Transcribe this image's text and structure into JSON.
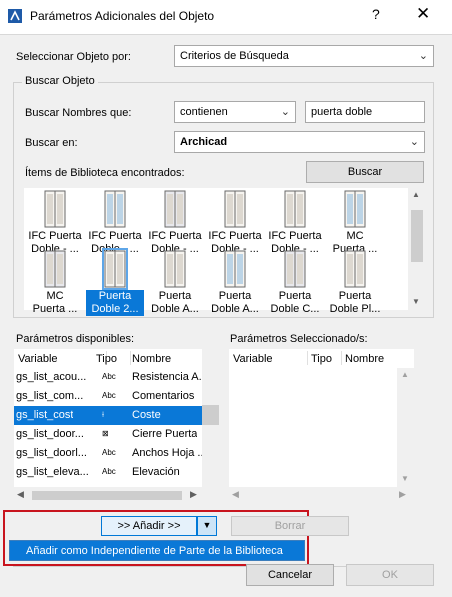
{
  "window": {
    "title": "Parámetros Adicionales del Objeto",
    "help": "?",
    "close": "✕"
  },
  "select_by": {
    "label": "Seleccionar Objeto por:",
    "value": "Criterios de Búsqueda"
  },
  "search": {
    "group_label": "Buscar Objeto",
    "names_label": "Buscar Nombres que:",
    "condition": "contienen",
    "query": "puerta doble",
    "search_in_label": "Buscar en:",
    "search_in": "Archicad",
    "found_label": "Ítems de Biblioteca encontrados:",
    "search_button": "Buscar"
  },
  "library_items": [
    {
      "label": "IFC Puerta\nDoble - ...",
      "icon": "door-icon"
    },
    {
      "label": "IFC Puerta\nDoble - ...",
      "icon": "door-icon"
    },
    {
      "label": "IFC Puerta\nDoble - ...",
      "icon": "door-icon"
    },
    {
      "label": "IFC Puerta\nDoble - ...",
      "icon": "door-icon"
    },
    {
      "label": "IFC Puerta\nDoble - ...",
      "icon": "door-icon"
    },
    {
      "label": "MC\nPuerta ...",
      "icon": "door-icon"
    },
    {
      "label": "MC\nPuerta ...",
      "icon": "door-icon"
    },
    {
      "label": "Puerta\nDoble 2...",
      "icon": "door-icon"
    },
    {
      "label": "Puerta\nDoble A...",
      "icon": "door-icon"
    },
    {
      "label": "Puerta\nDoble A...",
      "icon": "door-icon"
    },
    {
      "label": "Puerta\nDoble C...",
      "icon": "door-icon"
    },
    {
      "label": "Puerta\nDoble Pl...",
      "icon": "door-icon"
    }
  ],
  "available": {
    "label": "Parámetros disponibles:",
    "headers": {
      "variable": "Variable",
      "tipo": "Tipo",
      "nombre": "Nombre"
    },
    "rows": [
      {
        "variable": "gs_list_acou...",
        "tipo": "Abc",
        "nombre": "Resistencia A..."
      },
      {
        "variable": "gs_list_com...",
        "tipo": "Abc",
        "nombre": "Comentarios"
      },
      {
        "variable": "gs_list_cost",
        "tipo": "⟊",
        "nombre": "Coste"
      },
      {
        "variable": "gs_list_door...",
        "tipo": "⊠",
        "nombre": "Cierre Puerta"
      },
      {
        "variable": "gs_list_doorl...",
        "tipo": "Abc",
        "nombre": "Anchos Hoja ..."
      },
      {
        "variable": "gs_list_eleva...",
        "tipo": "Abc",
        "nombre": "Elevación"
      }
    ]
  },
  "selected": {
    "label": "Parámetros Seleccionado/s:",
    "headers": {
      "variable": "Variable",
      "tipo": "Tipo",
      "nombre": "Nombre"
    }
  },
  "actions": {
    "add_button": ">> Añadir >>",
    "remove_button": "Borrar",
    "menu_item": "Añadir como Independiente de Parte de la Biblioteca",
    "cancel": "Cancelar",
    "ok": "OK"
  },
  "colors": {
    "selection": "#0a78d7",
    "highlight_box": "#c8141e"
  }
}
